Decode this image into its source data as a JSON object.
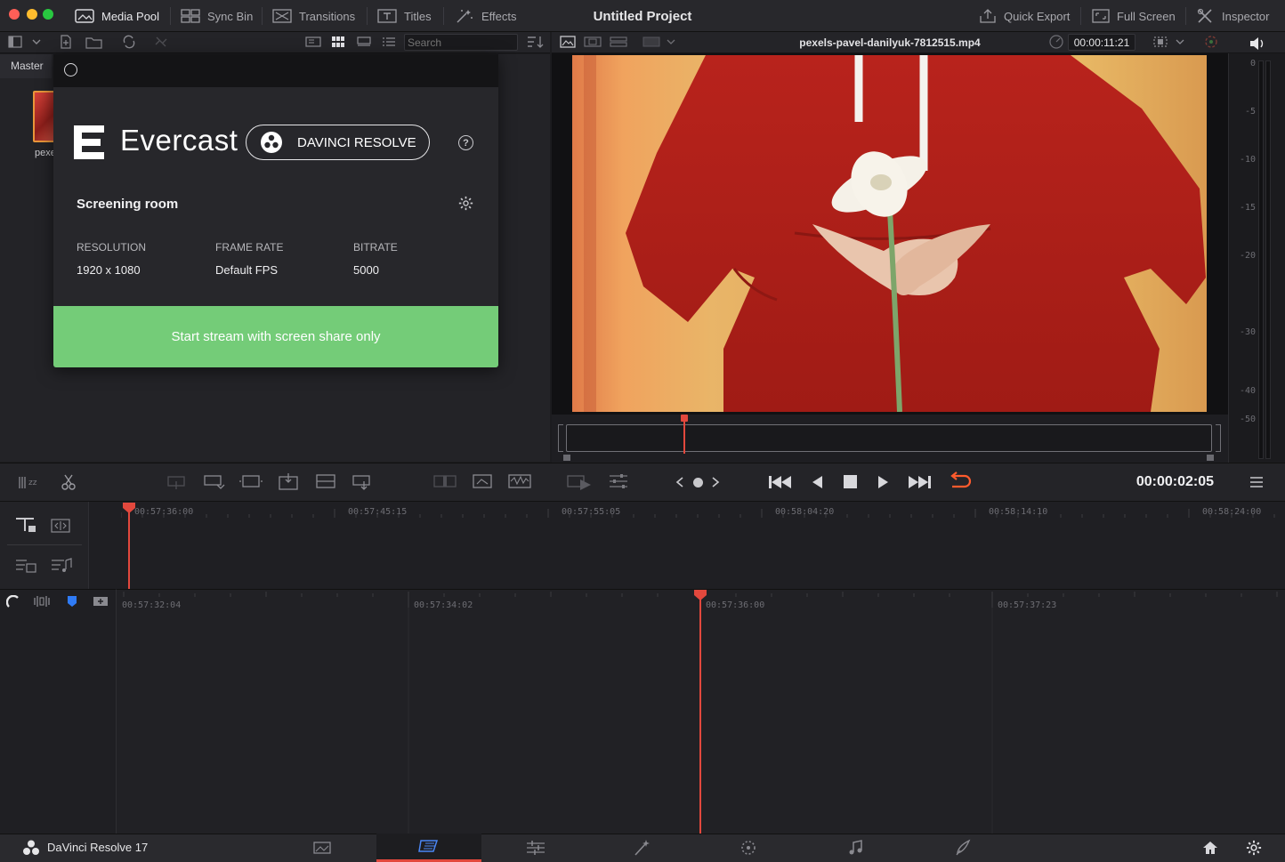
{
  "window": {
    "title": "Untitled Project"
  },
  "toolbar": {
    "media_pool": "Media Pool",
    "sync_bin": "Sync Bin",
    "transitions": "Transitions",
    "titles": "Titles",
    "effects": "Effects",
    "quick_export": "Quick Export",
    "full_screen": "Full Screen",
    "inspector": "Inspector"
  },
  "media_pool": {
    "search_placeholder": "Search",
    "bin_tab": "Master",
    "clip_label": "pexe"
  },
  "viewer": {
    "clip_name": "pexels-pavel-danilyuk-7812515.mp4",
    "duration": "00:00:11:21",
    "meter_ticks": [
      "0",
      "-5",
      "-10",
      "-15",
      "-20",
      "-30",
      "-40",
      "-50"
    ]
  },
  "evercast": {
    "brand": "Evercast",
    "app_badge": "DAVINCI RESOLVE",
    "room_title": "Screening room",
    "resolution_label": "RESOLUTION",
    "resolution_value": "1920 x 1080",
    "framerate_label": "FRAME RATE",
    "framerate_value": "Default FPS",
    "bitrate_label": "BITRATE",
    "bitrate_value": "5000",
    "cta_label": "Start stream with screen share only"
  },
  "transport": {
    "timecode": "00:00:02:05"
  },
  "timeline_upper": {
    "ticks": [
      "00:57:36:00",
      "00:57:45:15",
      "00:57:55:05",
      "00:58:04:20",
      "00:58:14:10",
      "00:58:24:00"
    ]
  },
  "timeline_lower": {
    "ticks": [
      "00:57:32:04",
      "00:57:34:02",
      "00:57:36:00",
      "00:57:37:23"
    ]
  },
  "footer": {
    "app_name": "DaVinci Resolve 17"
  },
  "colors": {
    "accent_red": "#e2483d",
    "cta_green": "#74cc78",
    "loop_orange": "#ff5b2d",
    "flag_blue": "#2f7bf6"
  }
}
